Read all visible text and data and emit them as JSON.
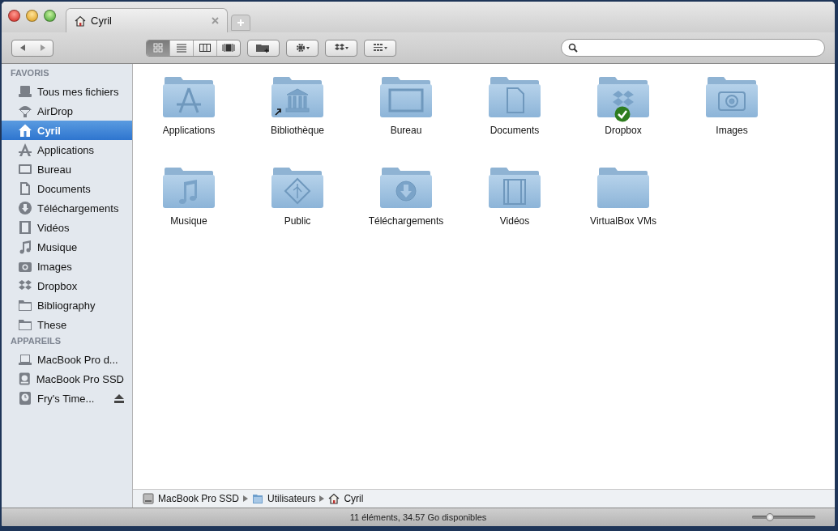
{
  "tab": {
    "label": "Cyril"
  },
  "view_modes": [
    {
      "kind": "icons",
      "selected": true
    },
    {
      "kind": "list",
      "selected": false
    },
    {
      "kind": "columns",
      "selected": false
    },
    {
      "kind": "coverflow",
      "selected": false
    }
  ],
  "sidebar": {
    "sections": [
      {
        "title": "FAVORIS",
        "items": [
          {
            "label": "Tous mes fichiers",
            "selected": false,
            "ejectable": false
          },
          {
            "label": "AirDrop",
            "selected": false,
            "ejectable": false
          },
          {
            "label": "Cyril",
            "selected": true,
            "ejectable": false
          },
          {
            "label": "Applications",
            "selected": false,
            "ejectable": false
          },
          {
            "label": "Bureau",
            "selected": false,
            "ejectable": false
          },
          {
            "label": "Documents",
            "selected": false,
            "ejectable": false
          },
          {
            "label": "Téléchargements",
            "selected": false,
            "ejectable": false
          },
          {
            "label": "Vidéos",
            "selected": false,
            "ejectable": false
          },
          {
            "label": "Musique",
            "selected": false,
            "ejectable": false
          },
          {
            "label": "Images",
            "selected": false,
            "ejectable": false
          },
          {
            "label": "Dropbox",
            "selected": false,
            "ejectable": false
          },
          {
            "label": "Bibliography",
            "selected": false,
            "ejectable": false
          },
          {
            "label": "These",
            "selected": false,
            "ejectable": false
          }
        ]
      },
      {
        "title": "APPAREILS",
        "items": [
          {
            "label": "MacBook Pro d...",
            "selected": false,
            "ejectable": false
          },
          {
            "label": "MacBook Pro SSD",
            "selected": false,
            "ejectable": false
          },
          {
            "label": "Fry's Time...",
            "selected": false,
            "ejectable": true
          }
        ]
      }
    ]
  },
  "folders": [
    {
      "label": "Applications"
    },
    {
      "label": "Bibliothèque"
    },
    {
      "label": "Bureau"
    },
    {
      "label": "Documents"
    },
    {
      "label": "Dropbox"
    },
    {
      "label": "Images"
    },
    {
      "label": "Musique"
    },
    {
      "label": "Public"
    },
    {
      "label": "Téléchargements"
    },
    {
      "label": "Vidéos"
    },
    {
      "label": "VirtualBox VMs"
    }
  ],
  "path_bar": [
    {
      "label": "MacBook Pro SSD"
    },
    {
      "label": "Utilisateurs"
    },
    {
      "label": "Cyril"
    }
  ],
  "status_bar": {
    "text": "11 éléments, 34.57 Go disponibles",
    "zoom": {
      "level": 0.25
    }
  }
}
